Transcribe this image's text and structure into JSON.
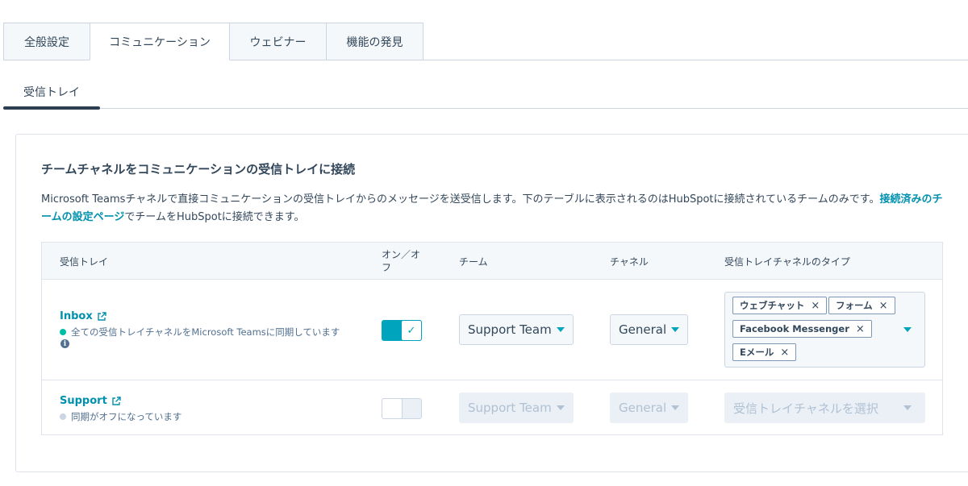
{
  "top_tabs": [
    {
      "label": "全般設定",
      "active": false
    },
    {
      "label": "コミュニケーション",
      "active": true
    },
    {
      "label": "ウェビナー",
      "active": false
    },
    {
      "label": "機能の発見",
      "active": false
    }
  ],
  "sub_tab": {
    "label": "受信トレイ"
  },
  "card": {
    "title": "チームチャネルをコミュニケーションの受信トレイに接続",
    "desc_text": "Microsoft Teamsチャネルで直接コミュニケーションの受信トレイからのメッセージを送受信します。下のテーブルに表示されるのはHubSpotに接続されているチームのみです。",
    "desc_link": "接続済みのチームの設定ページ",
    "desc_suffix": "でチームをHubSpotに接続できます。"
  },
  "table": {
    "headers": {
      "inbox": "受信トレイ",
      "onoff": "オン／オフ",
      "team": "チーム",
      "channel": "チャネル",
      "type": "受信トレイチャネルのタイプ"
    },
    "rows": [
      {
        "name": "Inbox",
        "status": "全ての受信トレイチャネルをMicrosoft Teamsに同期しています",
        "status_color": "#00bda5",
        "info": "i",
        "toggle_on": true,
        "team": "Support Team",
        "channel": "General",
        "channel_types": [
          "ウェブチャット",
          "フォーム",
          "Facebook Messenger",
          "Eメール"
        ]
      },
      {
        "name": "Support",
        "status": "同期がオフになっています",
        "status_color": "#cbd6e2",
        "toggle_on": false,
        "team": "Support Team",
        "channel": "General",
        "type_placeholder": "受信トレイチャネルを選択"
      }
    ]
  },
  "icons": {
    "external_link": "external-link-icon",
    "check": "check-icon",
    "remove": "×"
  },
  "colors": {
    "accent": "#00a4bd",
    "link": "#0091ae",
    "text": "#33475b"
  }
}
